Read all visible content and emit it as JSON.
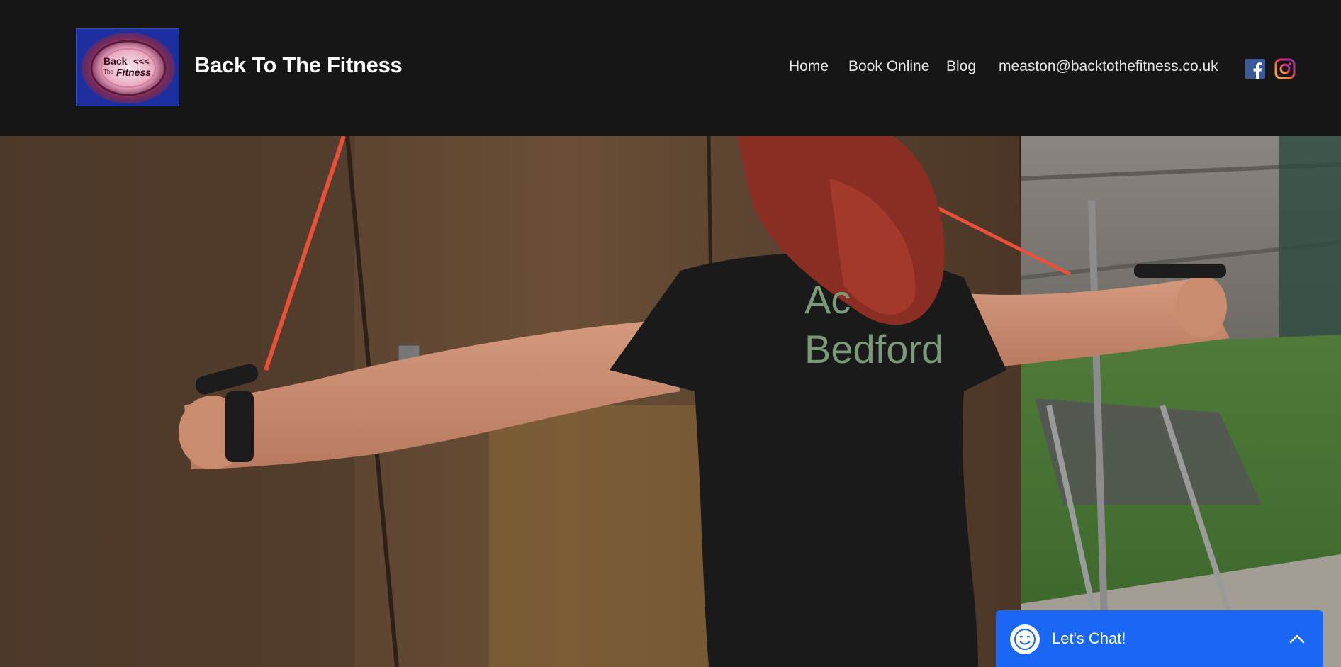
{
  "header": {
    "brand_name": "Back To The Fitness",
    "logo": {
      "line1": "Back",
      "line2": "The",
      "line3": "Fitness",
      "arrows": "<<<"
    }
  },
  "nav": {
    "items": [
      {
        "label": "Home"
      },
      {
        "label": "Book Online"
      },
      {
        "label": "Blog"
      }
    ],
    "email": "measton@backtothefitness.co.uk"
  },
  "social": {
    "facebook_icon": "facebook-icon",
    "instagram_icon": "instagram-icon"
  },
  "hero": {
    "shirt_text_line1": "Ac",
    "shirt_text_line2": "Bedford"
  },
  "chat": {
    "label": "Let's Chat!",
    "avatar_icon": "smiley-icon",
    "toggle_icon": "chevron-up-icon"
  },
  "colors": {
    "header_bg": "#161616",
    "chat_bg": "#1967f4",
    "facebook": "#3b5998",
    "band": "#e8503a"
  }
}
